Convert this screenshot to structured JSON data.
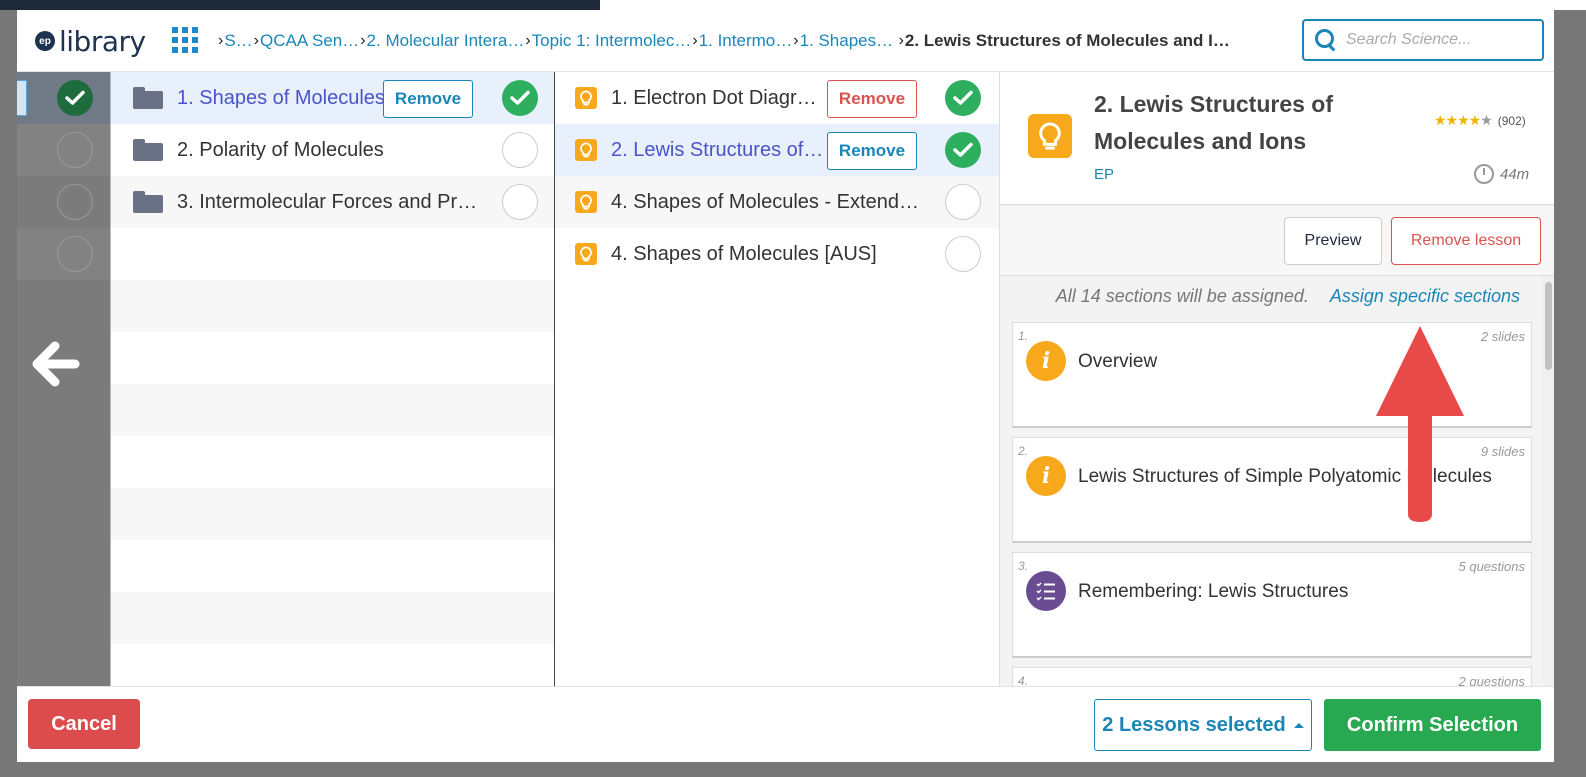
{
  "app": {
    "logo_badge": "ep",
    "logo_text": "library"
  },
  "breadcrumb": [
    {
      "label": "S…"
    },
    {
      "label": "QCAA Sen…"
    },
    {
      "label": "2. Molecular Intera…"
    },
    {
      "label": "Topic 1: Intermolec…"
    },
    {
      "label": "1. Intermo…"
    },
    {
      "label": "1. Shapes …"
    },
    {
      "label": "2. Lewis Structures of Molecules and I…"
    }
  ],
  "search": {
    "placeholder": "Search Science..."
  },
  "folders": [
    {
      "label": "1. Shapes of Molecules",
      "selected": true,
      "action": "Remove",
      "checked": true
    },
    {
      "label": "2. Polarity of Molecules",
      "selected": false,
      "checked": false
    },
    {
      "label": "3. Intermolecular Forces and Pr…",
      "selected": false,
      "checked": false
    }
  ],
  "lessons": [
    {
      "label": "1. Electron Dot Diagr…",
      "action": "Remove",
      "checked": true
    },
    {
      "label": "2. Lewis Structures of…",
      "action": "Remove",
      "checked": true,
      "selected": true
    },
    {
      "label": "4. Shapes of Molecules - Extend…",
      "checked": false
    },
    {
      "label": "4. Shapes of Molecules [AUS]",
      "checked": false
    }
  ],
  "detail": {
    "title": "2. Lewis Structures of Molecules and Ions",
    "author": "EP",
    "rating_count": "(902)",
    "rating_stars": 4,
    "duration": "44m",
    "preview_label": "Preview",
    "remove_label": "Remove lesson",
    "assign_info": "All 14 sections will be assigned.",
    "assign_link": "Assign specific sections",
    "sections": [
      {
        "num": "1.",
        "title": "Overview",
        "meta": "2 slides",
        "icon": "info"
      },
      {
        "num": "2.",
        "title": "Lewis Structures of Simple Polyatomic Molecules",
        "meta": "9 slides",
        "icon": "info"
      },
      {
        "num": "3.",
        "title": "Remembering: Lewis Structures",
        "meta": "5 questions",
        "icon": "quiz"
      },
      {
        "num": "4.",
        "title": "",
        "meta": "2 questions",
        "icon": "quiz"
      }
    ]
  },
  "footer": {
    "cancel_label": "Cancel",
    "lessons_selected_label": "2 Lessons selected",
    "confirm_label": "Confirm Selection"
  },
  "colors": {
    "accent": "#1a86b8",
    "success": "#28a850",
    "danger": "#dc4c4c",
    "lesson_icon": "#f7a81b",
    "quiz_icon": "#6a4c93",
    "annotation_arrow": "#e84a4a"
  }
}
